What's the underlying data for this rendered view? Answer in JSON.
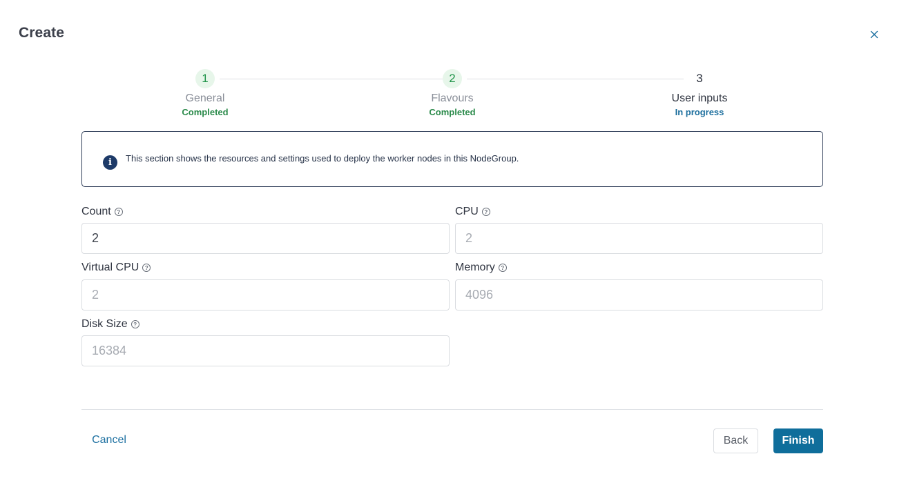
{
  "dialog": {
    "title": "Create",
    "close_icon": "close-icon"
  },
  "stepper": {
    "steps": [
      {
        "number": "1",
        "label": "General",
        "status": "Completed"
      },
      {
        "number": "2",
        "label": "Flavours",
        "status": "Completed"
      },
      {
        "number": "3",
        "label": "User inputs",
        "status": "In progress"
      }
    ]
  },
  "info": {
    "icon": "info-icon",
    "text": "This section shows the resources and settings used to deploy the worker nodes in this NodeGroup."
  },
  "fields": {
    "count": {
      "label": "Count",
      "value": "2"
    },
    "cpu": {
      "label": "CPU",
      "value": "2"
    },
    "virtual_cpu": {
      "label": "Virtual CPU",
      "value": "2"
    },
    "memory": {
      "label": "Memory",
      "value": "4096"
    },
    "disk_size": {
      "label": "Disk Size",
      "value": "16384"
    }
  },
  "footer": {
    "cancel_label": "Cancel",
    "back_label": "Back",
    "finish_label": "Finish"
  },
  "colors": {
    "accent": "#0f6e9b",
    "success": "#2a8a4a",
    "info": "#1d3a68"
  }
}
